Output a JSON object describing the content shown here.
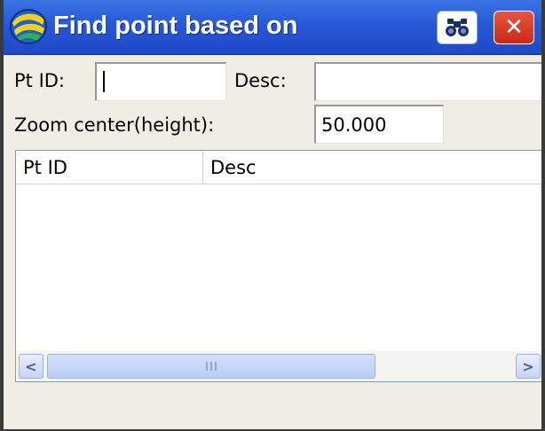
{
  "window": {
    "title": "Find point based on"
  },
  "titlebar": {
    "find_button_icon": "binoculars-icon",
    "close_button_icon": "close-icon",
    "close_symbol": "✕"
  },
  "form": {
    "pt_id_label": "Pt ID:",
    "pt_id_value": "",
    "desc_label": "Desc:",
    "desc_value": "",
    "zoom_label": "Zoom center(height):",
    "zoom_value": "50.000"
  },
  "list": {
    "columns": [
      "Pt ID",
      "Desc"
    ],
    "rows": []
  },
  "scrollbar": {
    "left_arrow": "<",
    "right_arrow": ">"
  },
  "colors": {
    "titlebar": "#2858d6",
    "close_button": "#c92a14",
    "window_bg": "#f0eee4"
  }
}
